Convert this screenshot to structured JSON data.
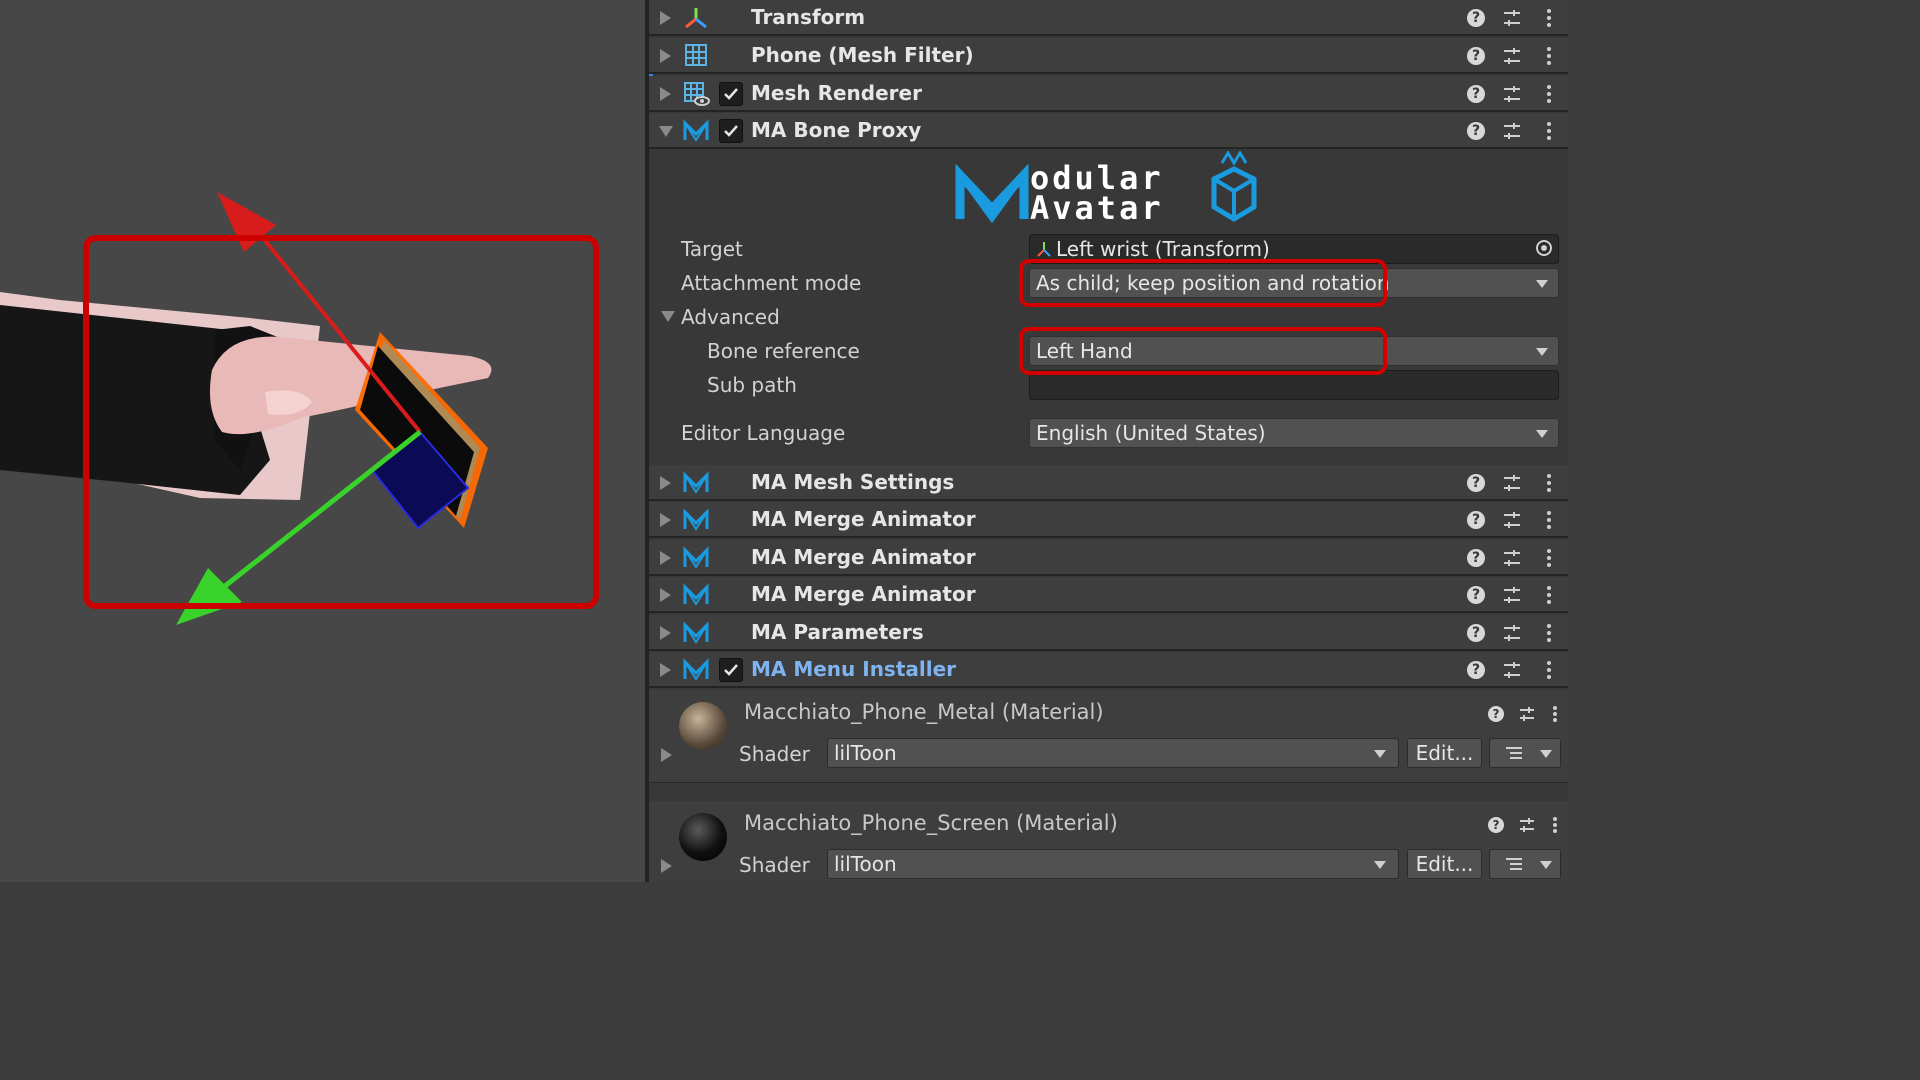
{
  "viewport": {
    "handles": {
      "x_axis_color": "#d81c1c",
      "y_axis_color": "#39d22b",
      "selection_color": "#ff6a00"
    },
    "highlight_color": "#cc0000"
  },
  "inspector": {
    "components": [
      {
        "icon": "transform-icon",
        "title": "Transform",
        "expanded": false,
        "checkbox": false
      },
      {
        "icon": "mesh-filter-icon",
        "title": "Phone (Mesh Filter)",
        "expanded": false,
        "checkbox": false
      },
      {
        "icon": "mesh-renderer-icon",
        "title": "Mesh Renderer",
        "expanded": false,
        "checkbox": true,
        "checked": true
      },
      {
        "icon": "ma-icon",
        "title": "MA Bone Proxy",
        "expanded": true,
        "checkbox": true,
        "checked": true
      },
      {
        "icon": "ma-icon",
        "title": "MA Mesh Settings",
        "expanded": false,
        "checkbox": false
      },
      {
        "icon": "ma-icon",
        "title": "MA Merge Animator",
        "expanded": false,
        "checkbox": false
      },
      {
        "icon": "ma-icon",
        "title": "MA Merge Animator",
        "expanded": false,
        "checkbox": false
      },
      {
        "icon": "ma-icon",
        "title": "MA Merge Animator",
        "expanded": false,
        "checkbox": false
      },
      {
        "icon": "ma-icon",
        "title": "MA Parameters",
        "expanded": false,
        "checkbox": false
      },
      {
        "icon": "ma-icon",
        "title": "MA Menu Installer",
        "expanded": false,
        "checkbox": true,
        "checked": true,
        "highlight_color": "#7fb4f0"
      }
    ],
    "bone_proxy": {
      "logo": {
        "line1": "odular",
        "line2": "Avatar",
        "color": "#1a9be0"
      },
      "target_label": "Target",
      "target_value": "Left wrist (Transform)",
      "attachment_label": "Attachment mode",
      "attachment_value": "As child; keep position and rotation",
      "advanced_label": "Advanced",
      "bone_ref_label": "Bone reference",
      "bone_ref_value": "Left Hand",
      "subpath_label": "Sub path",
      "subpath_value": "",
      "language_label": "Editor Language",
      "language_value": "English (United States)"
    },
    "materials": [
      {
        "name": "Macchiato_Phone_Metal (Material)",
        "shader_label": "Shader",
        "shader_value": "lilToon",
        "edit_label": "Edit...",
        "preview": "metal"
      },
      {
        "name": "Macchiato_Phone_Screen (Material)",
        "shader_label": "Shader",
        "shader_value": "lilToon",
        "edit_label": "Edit...",
        "preview": "screen"
      }
    ]
  }
}
